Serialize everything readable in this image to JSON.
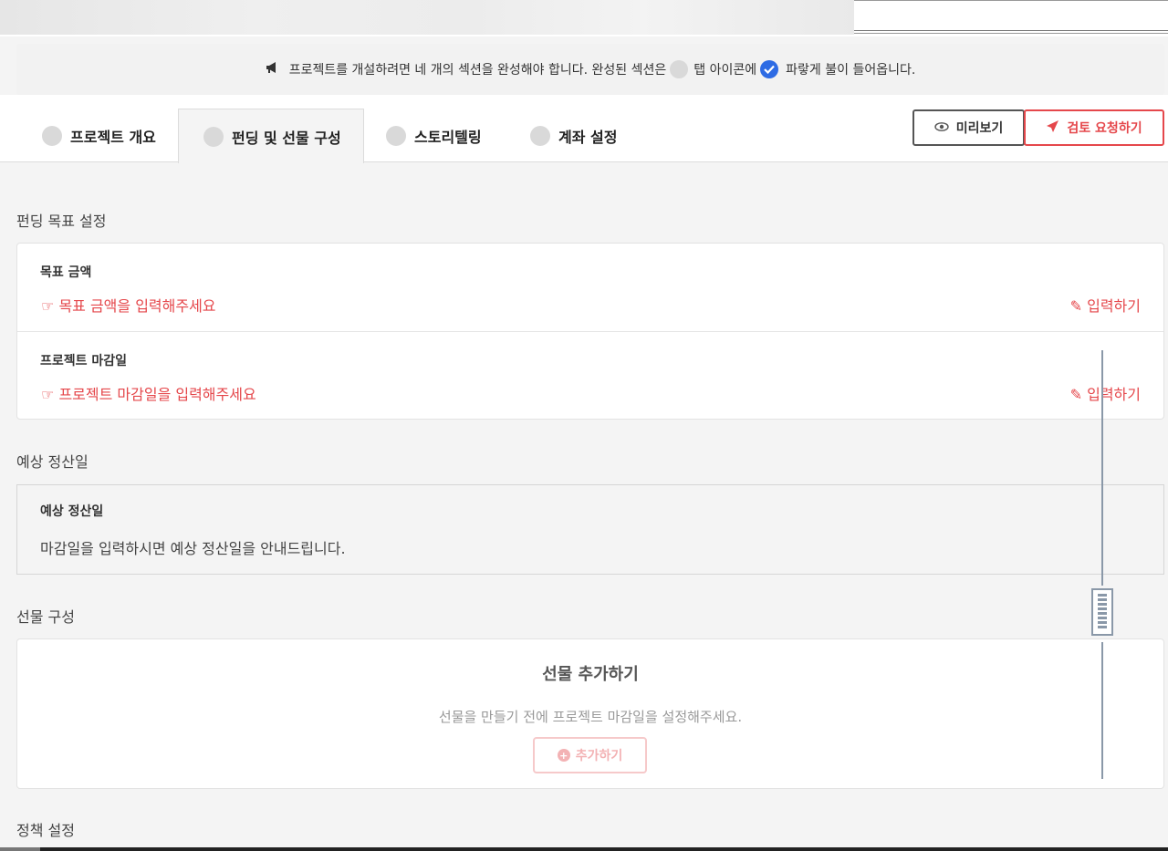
{
  "notice": {
    "part1": "프로젝트를 개설하려면 네 개의 섹션을 완성해야 합니다. 완성된 섹션은",
    "part2": "탭 아이콘에",
    "part3": "파랗게 불이 들어옵니다."
  },
  "tabs": [
    {
      "label": "프로젝트 개요",
      "active": false
    },
    {
      "label": "펀딩 및 선물 구성",
      "active": true
    },
    {
      "label": "스토리텔링",
      "active": false
    },
    {
      "label": "계좌 설정",
      "active": false
    }
  ],
  "actions": {
    "preview_label": "미리보기",
    "review_label": "검토 요청하기"
  },
  "funding_goal": {
    "section_title": "펀딩 목표 설정",
    "rows": [
      {
        "label": "목표 금액",
        "prompt": "목표 금액을 입력해주세요",
        "edit_label": "입력하기"
      },
      {
        "label": "프로젝트 마감일",
        "prompt": "프로젝트 마감일을 입력해주세요",
        "edit_label": "입력하기"
      }
    ]
  },
  "settlement": {
    "section_title": "예상 정산일",
    "label": "예상 정산일",
    "description": "마감일을 입력하시면 예상 정산일을 안내드립니다."
  },
  "gifts": {
    "section_title": "선물 구성",
    "title": "선물 추가하기",
    "description": "선물을 만들기 전에 프로젝트 마감일을 설정해주세요.",
    "add_label": "추가하기"
  },
  "policy": {
    "section_title": "정책 설정"
  },
  "colors": {
    "accent": "#e5474b",
    "check_blue": "#2d6be4",
    "background": "#f4f4f4"
  },
  "icons": {
    "notice": "megaphone-icon",
    "complete": "check-circle-icon",
    "preview": "eye-icon",
    "review": "paper-plane-icon",
    "prompt": "hand-pointing-icon",
    "edit": "edit-icon",
    "add": "plus-circle-icon"
  }
}
